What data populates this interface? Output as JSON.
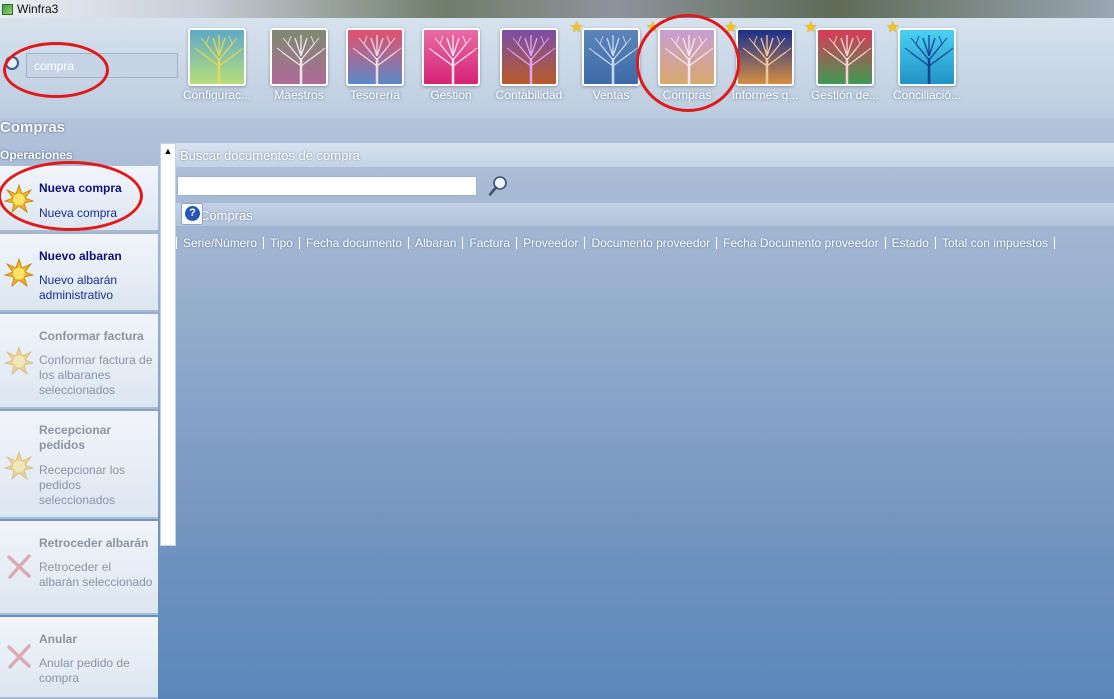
{
  "window": {
    "title": "Winfra3"
  },
  "search": {
    "value": "compra"
  },
  "modules": [
    {
      "label": "Configurac...",
      "icon": "tree-green-icon",
      "starred": false
    },
    {
      "label": "Maestros",
      "icon": "tree-grey-icon",
      "starred": false
    },
    {
      "label": "Tesorería",
      "icon": "tree-red-icon",
      "starred": false
    },
    {
      "label": "Gestion",
      "icon": "tree-pink-icon",
      "starred": false
    },
    {
      "label": "Contabilidad",
      "icon": "tree-purple-icon",
      "starred": false
    },
    {
      "label": "Ventas",
      "icon": "tree-blue-icon",
      "starred": true
    },
    {
      "label": "Compras",
      "icon": "tree-peach-icon",
      "starred": true
    },
    {
      "label": "Informes g...",
      "icon": "tree-navy-icon",
      "starred": true
    },
    {
      "label": "Gestión de...",
      "icon": "tree-crimson-icon",
      "starred": true
    },
    {
      "label": "Conciliació...",
      "icon": "tree-cyan-icon",
      "starred": true
    }
  ],
  "page": {
    "title": "Compras"
  },
  "operations": {
    "header": "Operaciones",
    "items": [
      {
        "title": "Nueva compra",
        "desc": "Nueva compra",
        "enabled": true,
        "icon": "sun-icon"
      },
      {
        "title": "Nuevo albaran",
        "desc": "Nuevo albarán administrativo",
        "enabled": true,
        "icon": "sun-icon"
      },
      {
        "title": "Conformar factura",
        "desc": "Conformar factura de los albaranes seleccionados",
        "enabled": false,
        "icon": "sun-icon"
      },
      {
        "title": "Recepcionar pedidos",
        "desc": "Recepcionar los pedidos seleccionados",
        "enabled": false,
        "icon": "sun-icon"
      },
      {
        "title": "Retroceder albarán",
        "desc": "Retroceder el albarán seleccionado",
        "enabled": false,
        "icon": "x-icon"
      },
      {
        "title": "Anular",
        "desc": "Anular pedido de compra",
        "enabled": false,
        "icon": "x-icon"
      }
    ]
  },
  "documents": {
    "search_label": "Buscar documentos de compra",
    "section_title": "Compras",
    "columns": [
      "Serie/Número",
      "Tipo",
      "Fecha documento",
      "Albaran",
      "Factura",
      "Proveedor",
      "Documento proveedor",
      "Fecha Documento proveedor",
      "Estado",
      "Total con impuestos"
    ]
  },
  "colors": {
    "annotation_circle": "#e01a1a",
    "link_blue": "#10107a"
  }
}
